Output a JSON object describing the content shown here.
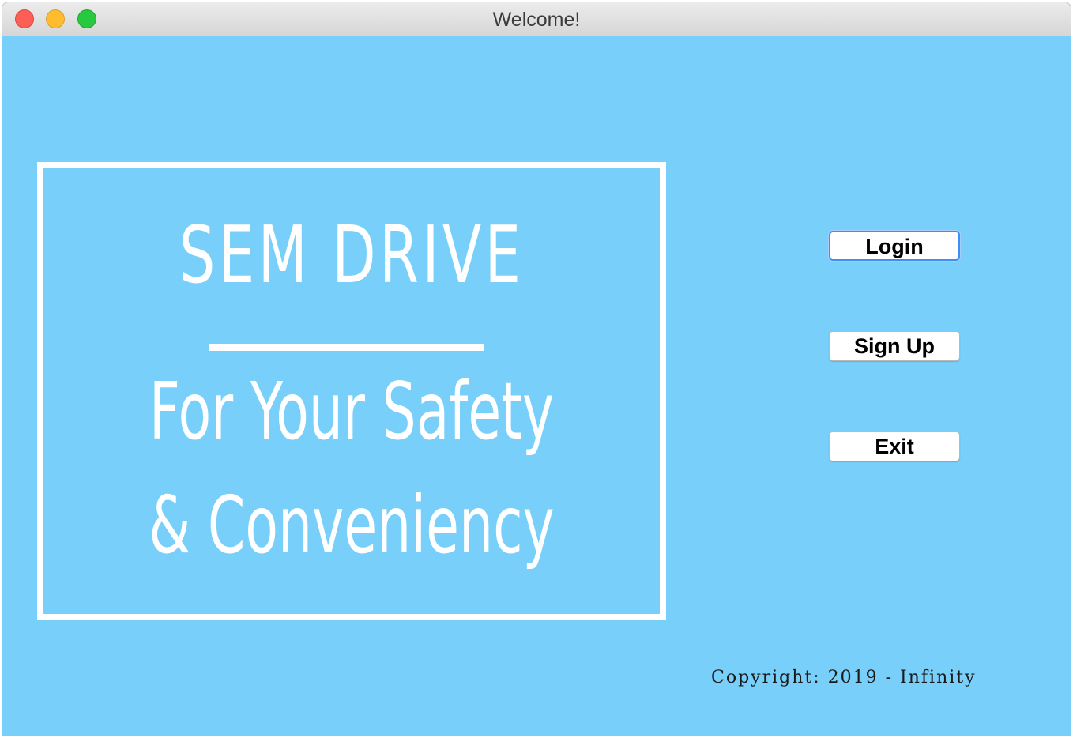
{
  "window": {
    "title": "Welcome!",
    "background_color": "#77cffa"
  },
  "logo": {
    "title": "SEM DRIVE",
    "tagline_line1": "For Your Safety",
    "tagline_line2": "& Conveniency"
  },
  "actions": {
    "login_label": "Login",
    "signup_label": "Sign Up",
    "exit_label": "Exit",
    "focused_button": "Login"
  },
  "footer": {
    "copyright": "Copyright: 2019 - Infinity"
  }
}
